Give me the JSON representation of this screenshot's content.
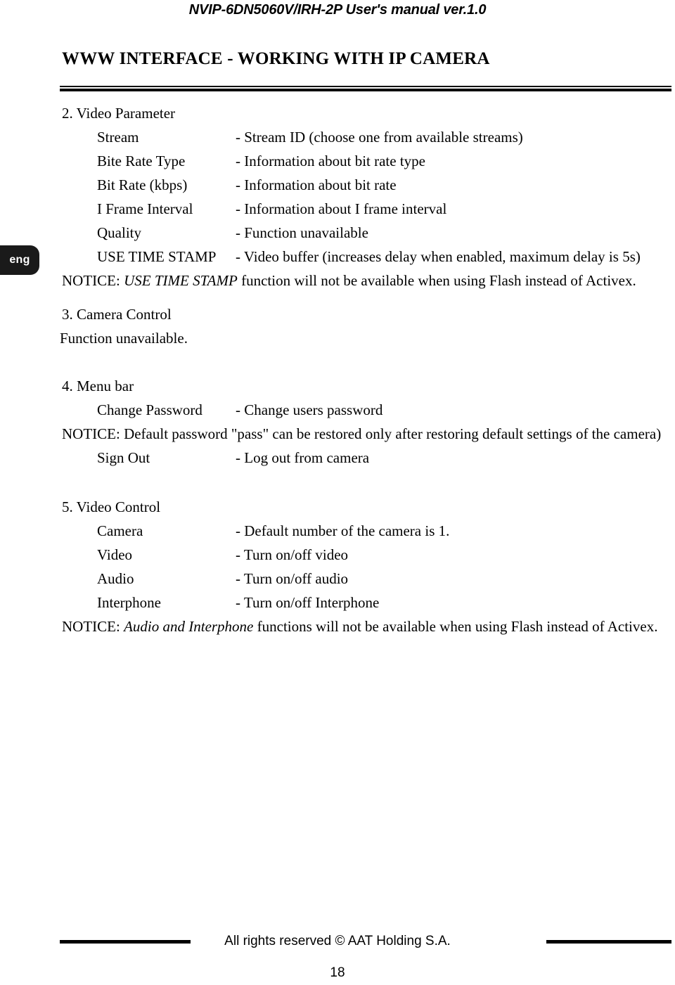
{
  "header": {
    "running_title": "NVIP-6DN5060V/IRH-2P User's manual ver.1.0"
  },
  "chapter": {
    "title": "WWW INTERFACE - WORKING WITH IP CAMERA"
  },
  "language_tab": {
    "label": "eng"
  },
  "sections": [
    {
      "heading": "2. Video Parameter",
      "rows": [
        {
          "term": "Stream",
          "desc": "- Stream ID (choose one from available streams)"
        },
        {
          "term": "Bite Rate Type",
          "desc": "- Information about bit rate type"
        },
        {
          "term": "Bit Rate (kbps)",
          "desc": "- Information about bit rate"
        },
        {
          "term": "I Frame Interval",
          "desc": "- Information about I frame interval"
        },
        {
          "term": "Quality",
          "desc": "- Function unavailable"
        },
        {
          "term": "USE TIME STAMP",
          "desc": "- Video buffer (increases delay when enabled, maximum delay is 5s)"
        }
      ],
      "notice": {
        "prefix": "NOTICE: ",
        "emphasis": "USE TIME STAMP",
        "suffix": " function will not be available when using Flash instead of Activex."
      }
    },
    {
      "heading": "3. Camera Control",
      "plain": "Function unavailable."
    },
    {
      "heading": "4. Menu bar",
      "rows_before_notice": [
        {
          "term": "Change Password",
          "desc": "- Change users password"
        }
      ],
      "notice": {
        "prefix": "NOTICE: Default password \"pass\" can be restored only after restoring default settings of the camera)",
        "emphasis": "",
        "suffix": ""
      },
      "rows_after_notice": [
        {
          "term": "Sign Out",
          "desc": "- Log out from camera"
        }
      ]
    },
    {
      "heading": "5. Video Control",
      "rows": [
        {
          "term": "Camera",
          "desc": "- Default number of the camera is 1."
        },
        {
          "term": "Video",
          "desc": "- Turn on/off video"
        },
        {
          "term": "Audio",
          "desc": "- Turn on/off audio"
        },
        {
          "term": "Interphone",
          "desc": "- Turn on/off Interphone"
        }
      ],
      "notice": {
        "prefix": "NOTICE: ",
        "emphasis": "Audio and Interphone",
        "suffix": " functions will not be available when using Flash instead of Activex."
      }
    }
  ],
  "footer": {
    "copyright": "All rights reserved © AAT Holding S.A.",
    "page_number": "18"
  }
}
